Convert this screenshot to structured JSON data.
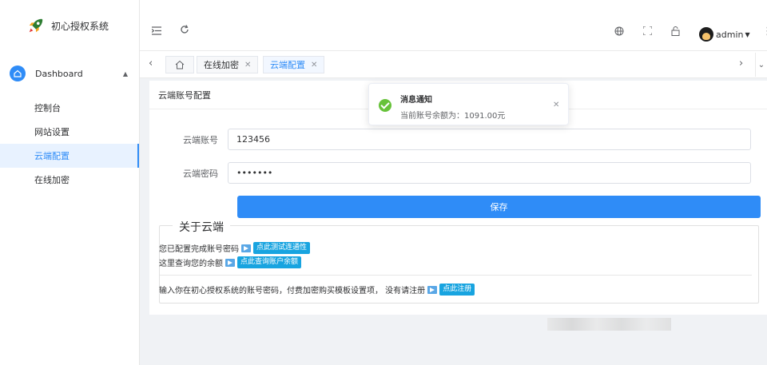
{
  "app": {
    "title": "初心授权系统",
    "brand_color": "#2f8cf7"
  },
  "sidebar": {
    "group": {
      "label": "Dashboard",
      "icon": "home-icon",
      "expanded": true
    },
    "items": [
      {
        "label": "控制台",
        "active": false
      },
      {
        "label": "网站设置",
        "active": false
      },
      {
        "label": "云端配置",
        "active": true
      },
      {
        "label": "在线加密",
        "active": false
      }
    ]
  },
  "header": {
    "icons": [
      "menu-fold-icon",
      "refresh-icon",
      "globe-icon",
      "fullscreen-icon",
      "lock-icon",
      "more-icon"
    ],
    "user": {
      "name": "admin"
    }
  },
  "tabs": [
    {
      "label": "在线加密",
      "active": false
    },
    {
      "label": "云端配置",
      "active": true
    }
  ],
  "card": {
    "title": "云端账号配置",
    "account_label": "云端账号",
    "account_value": "123456",
    "password_label": "云端密码",
    "password_value": "•••••••",
    "save_label": "保存"
  },
  "about": {
    "legend": "关于云端",
    "line1_text": "您已配置完成账号密码",
    "line1_button": "点此测试连通性",
    "line2_text": "这里查询您的余额",
    "line2_button": "点此查询账户余额",
    "line3_text": "输入你在初心授权系统的账号密码，付费加密购买模板设置项， 没有请注册",
    "line3_button": "点此注册"
  },
  "notification": {
    "title": "消息通知",
    "message": "当前账号余额为：1091.00元",
    "type": "success",
    "color": "#67c23a"
  }
}
